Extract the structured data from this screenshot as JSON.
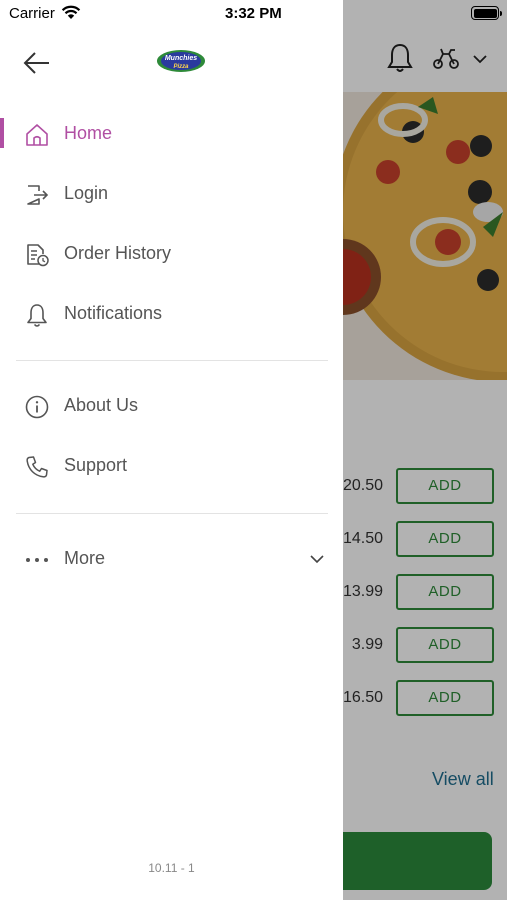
{
  "status_bar": {
    "carrier": "Carrier",
    "time": "3:32 PM"
  },
  "drawer": {
    "logo": {
      "line1": "Munchies",
      "line2": "Pizza"
    },
    "nav_items": [
      {
        "label": "Home",
        "icon": "home-icon",
        "active": true
      },
      {
        "label": "Login",
        "icon": "login-icon",
        "active": false
      },
      {
        "label": "Order History",
        "icon": "order-history-icon",
        "active": false
      },
      {
        "label": "Notifications",
        "icon": "bell-icon",
        "active": false
      }
    ],
    "info_items": [
      {
        "label": "About Us",
        "icon": "info-icon"
      },
      {
        "label": "Support",
        "icon": "phone-icon"
      }
    ],
    "more": {
      "label": "More",
      "icon": "ellipsis-icon"
    },
    "version": "10.11 - 1"
  },
  "background": {
    "prices": [
      "20.50",
      "14.50",
      "13.99",
      "3.99",
      "16.50"
    ],
    "add_label": "ADD",
    "view_all": "View all"
  },
  "colors": {
    "accent": "#b04fa3",
    "green": "#2f8a3a",
    "link": "#1f6d8f"
  }
}
